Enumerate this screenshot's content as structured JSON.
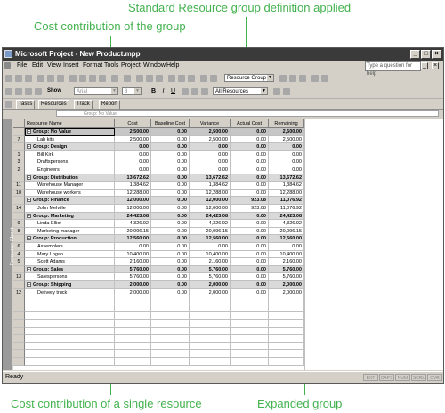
{
  "callouts": {
    "top": "Standard Resource group definition applied",
    "left": "Cost contribution of the group",
    "bottom_left": "Cost contribution of a single resource",
    "bottom_right": "Expanded group"
  },
  "window": {
    "title": "Microsoft Project - New Product.mpp",
    "controls": [
      "_",
      "□",
      "×"
    ]
  },
  "menu": {
    "items": [
      "File",
      "Edit",
      "View",
      "Insert",
      "Format",
      "Tools",
      "Project",
      "Window",
      "Help"
    ],
    "ask_placeholder": "Type a question for help"
  },
  "toolbar": {
    "group_combo": "Resource Group",
    "show_label": "Show",
    "font_combo": "Arial",
    "size_combo": "8",
    "filter_combo": "All Resources",
    "bold": "B",
    "italic": "I",
    "underline": "U"
  },
  "guide_toolbar": {
    "buttons": [
      "Tasks",
      "Resources",
      "Track",
      "Report"
    ]
  },
  "entry_bar": {
    "value": "Group: No Value"
  },
  "view_bar_label": "Resource Sheet",
  "table": {
    "columns": [
      "Resource Name",
      "Cost",
      "Baseline Cost",
      "Variance",
      "Actual Cost",
      "Remaining"
    ],
    "rows": [
      {
        "id": "",
        "name": "Group: No Value",
        "cost": "2,500.00",
        "baseline": "0.00",
        "variance": "2,500.00",
        "actual": "0.00",
        "remaining": "2,500.00",
        "kind": "group"
      },
      {
        "id": "7",
        "name": "Lab kits",
        "cost": "2,500.00",
        "baseline": "0.00",
        "variance": "2,500.00",
        "actual": "0.00",
        "remaining": "2,500.00",
        "kind": "item"
      },
      {
        "id": "",
        "name": "Group: Design",
        "cost": "0.00",
        "baseline": "0.00",
        "variance": "0.00",
        "actual": "0.00",
        "remaining": "0.00",
        "kind": "group"
      },
      {
        "id": "1",
        "name": "Bill Kirk",
        "cost": "0.00",
        "baseline": "0.00",
        "variance": "0.00",
        "actual": "0.00",
        "remaining": "0.00",
        "kind": "item"
      },
      {
        "id": "3",
        "name": "Draftspersons",
        "cost": "0.00",
        "baseline": "0.00",
        "variance": "0.00",
        "actual": "0.00",
        "remaining": "0.00",
        "kind": "item"
      },
      {
        "id": "2",
        "name": "Engineers",
        "cost": "0.00",
        "baseline": "0.00",
        "variance": "0.00",
        "actual": "0.00",
        "remaining": "0.00",
        "kind": "item"
      },
      {
        "id": "",
        "name": "Group: Distribution",
        "cost": "13,672.62",
        "baseline": "0.00",
        "variance": "13,672.62",
        "actual": "0.00",
        "remaining": "13,672.62",
        "kind": "group"
      },
      {
        "id": "11",
        "name": "Warehouse Manager",
        "cost": "1,384.62",
        "baseline": "0.00",
        "variance": "1,384.62",
        "actual": "0.00",
        "remaining": "1,384.62",
        "kind": "item"
      },
      {
        "id": "10",
        "name": "Warehouse workers",
        "cost": "12,288.00",
        "baseline": "0.00",
        "variance": "12,288.00",
        "actual": "0.00",
        "remaining": "12,288.00",
        "kind": "item"
      },
      {
        "id": "",
        "name": "Group: Finance",
        "cost": "12,000.00",
        "baseline": "0.00",
        "variance": "12,000.00",
        "actual": "923.08",
        "remaining": "11,076.92",
        "kind": "group"
      },
      {
        "id": "14",
        "name": "John Melville",
        "cost": "12,000.00",
        "baseline": "0.00",
        "variance": "12,000.00",
        "actual": "923.08",
        "remaining": "11,076.92",
        "kind": "item"
      },
      {
        "id": "",
        "name": "Group: Marketing",
        "cost": "24,423.08",
        "baseline": "0.00",
        "variance": "24,423.08",
        "actual": "0.00",
        "remaining": "24,423.08",
        "kind": "group"
      },
      {
        "id": "9",
        "name": "Linda Elliot",
        "cost": "4,326.92",
        "baseline": "0.00",
        "variance": "4,326.92",
        "actual": "0.00",
        "remaining": "4,326.92",
        "kind": "item"
      },
      {
        "id": "8",
        "name": "Marketing manager",
        "cost": "20,096.15",
        "baseline": "0.00",
        "variance": "20,096.15",
        "actual": "0.00",
        "remaining": "20,096.15",
        "kind": "item"
      },
      {
        "id": "",
        "name": "Group: Production",
        "cost": "12,560.00",
        "baseline": "0.00",
        "variance": "12,560.00",
        "actual": "0.00",
        "remaining": "12,560.00",
        "kind": "group"
      },
      {
        "id": "6",
        "name": "Assemblers",
        "cost": "0.00",
        "baseline": "0.00",
        "variance": "0.00",
        "actual": "0.00",
        "remaining": "0.00",
        "kind": "item"
      },
      {
        "id": "4",
        "name": "Mary Logan",
        "cost": "10,400.00",
        "baseline": "0.00",
        "variance": "10,400.00",
        "actual": "0.00",
        "remaining": "10,400.00",
        "kind": "item"
      },
      {
        "id": "5",
        "name": "Scott Adams",
        "cost": "2,160.00",
        "baseline": "0.00",
        "variance": "2,160.00",
        "actual": "0.00",
        "remaining": "2,160.00",
        "kind": "item"
      },
      {
        "id": "",
        "name": "Group: Sales",
        "cost": "5,760.00",
        "baseline": "0.00",
        "variance": "5,760.00",
        "actual": "0.00",
        "remaining": "5,760.00",
        "kind": "group"
      },
      {
        "id": "13",
        "name": "Salespersons",
        "cost": "5,760.00",
        "baseline": "0.00",
        "variance": "5,760.00",
        "actual": "0.00",
        "remaining": "5,760.00",
        "kind": "item"
      },
      {
        "id": "",
        "name": "Group: Shipping",
        "cost": "2,000.00",
        "baseline": "0.00",
        "variance": "2,000.00",
        "actual": "0.00",
        "remaining": "2,000.00",
        "kind": "group"
      },
      {
        "id": "12",
        "name": "Delivery truck",
        "cost": "2,000.00",
        "baseline": "0.00",
        "variance": "2,000.00",
        "actual": "0.00",
        "remaining": "2,000.00",
        "kind": "item"
      }
    ]
  },
  "status": {
    "text": "Ready",
    "indicators": [
      "EXT",
      "CAPS",
      "NUM",
      "SCRL",
      "OVR"
    ]
  }
}
